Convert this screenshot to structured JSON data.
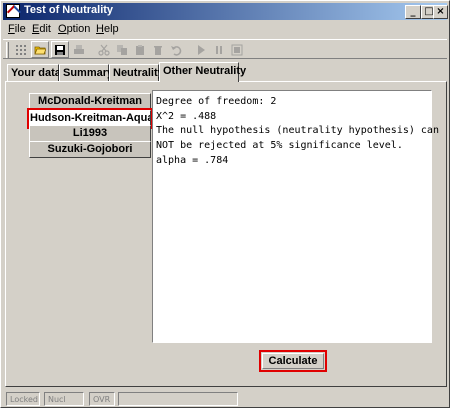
{
  "window": {
    "title": "Test of Neutrality",
    "minimize": "_",
    "maximize": "□",
    "close": "×"
  },
  "menu": {
    "file": {
      "key": "F",
      "rest": "ile"
    },
    "edit": {
      "key": "E",
      "rest": "dit"
    },
    "option": {
      "key": "O",
      "rest": "ption"
    },
    "help": {
      "key": "H",
      "rest": "elp"
    }
  },
  "toolbar": {
    "icons": [
      "grid-icon",
      "open-folder-icon",
      "save-icon",
      "print-icon",
      "cut-icon",
      "copy-icon",
      "paste-icon",
      "delete-icon",
      "undo-icon",
      "play-icon",
      "pause-icon",
      "stop-icon"
    ]
  },
  "tabs": [
    "Your data",
    "Summary",
    "Neutrality",
    "Other Neutrality"
  ],
  "active_tab": "Other Neutrality",
  "methods": [
    "McDonald-Kreitman",
    "Hudson-Kreitman-Aquade",
    "Li1993",
    "Suzuki-Gojobori"
  ],
  "selected_method": "Hudson-Kreitman-Aquade",
  "result": {
    "lines": [
      "Degree of freedom: 2",
      "X^2 = .488",
      "The null hypothesis (neutrality hypothesis) can",
      "NOT be rejected at 5% significance level.",
      "alpha = .784"
    ]
  },
  "calculate_label": "Calculate",
  "status": {
    "locked": "Locked",
    "nucl": "Nucl",
    "ovr": "OVR"
  },
  "colors": {
    "highlight": "#e00000",
    "title_start": "#0a246a",
    "title_end": "#a6caf0"
  }
}
